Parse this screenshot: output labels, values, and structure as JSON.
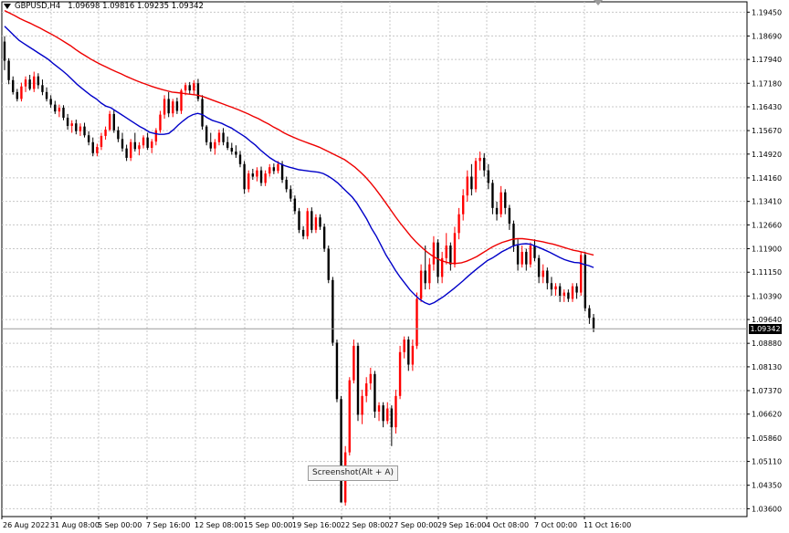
{
  "header": {
    "symbol": "GBPUSD",
    "timeframe": "H4",
    "ohlc": "1.09698 1.09816 1.09235 1.09342"
  },
  "current_price_label": "1.09342",
  "screenshot_hint": "Screenshot(Alt + A)",
  "colors": {
    "background": "#ffffff",
    "grid": "#c8c8c8",
    "bull_candle": "#ff0000",
    "bear_candle": "#000000",
    "ma_fast": "#0000c8",
    "ma_slow": "#ee0000",
    "axis_text": "#000000"
  },
  "chart_data": {
    "type": "candlestick",
    "symbol": "GBPUSD",
    "timeframe": "H4",
    "x_tick_labels": [
      "26 Aug 2022",
      "31 Aug 08:00",
      "5 Sep 00:00",
      "7 Sep 16:00",
      "12 Sep 08:00",
      "15 Sep 00:00",
      "19 Sep 16:00",
      "22 Sep 08:00",
      "27 Sep 00:00",
      "29 Sep 16:00",
      "4 Oct 08:00",
      "7 Oct 00:00",
      "11 Oct 16:00"
    ],
    "y_tick_labels": [
      "1.19450",
      "1.18690",
      "1.17940",
      "1.17180",
      "1.16430",
      "1.15670",
      "1.14920",
      "1.14160",
      "1.13410",
      "1.12660",
      "1.11900",
      "1.11150",
      "1.10390",
      "1.09640",
      "1.08880",
      "1.08130",
      "1.07370",
      "1.06620",
      "1.05860",
      "1.05110",
      "1.04350",
      "1.03600"
    ],
    "ylim": [
      1.0335,
      1.1978
    ],
    "last_price": 1.09342,
    "grid": true,
    "candles": [
      [
        1.1851,
        1.1868,
        1.176,
        1.179
      ],
      [
        1.179,
        1.1798,
        1.1715,
        1.1728
      ],
      [
        1.1728,
        1.174,
        1.1682,
        1.169
      ],
      [
        1.169,
        1.17,
        1.166,
        1.1668
      ],
      [
        1.1668,
        1.172,
        1.166,
        1.1708
      ],
      [
        1.1708,
        1.174,
        1.169,
        1.173
      ],
      [
        1.173,
        1.1745,
        1.1695,
        1.17
      ],
      [
        1.17,
        1.1755,
        1.169,
        1.174
      ],
      [
        1.174,
        1.175,
        1.17,
        1.1712
      ],
      [
        1.1712,
        1.173,
        1.168,
        1.169
      ],
      [
        1.169,
        1.1705,
        1.166,
        1.1668
      ],
      [
        1.1668,
        1.168,
        1.164,
        1.165
      ],
      [
        1.165,
        1.1662,
        1.162,
        1.1628
      ],
      [
        1.1628,
        1.165,
        1.161,
        1.164
      ],
      [
        1.164,
        1.1648,
        1.16,
        1.1608
      ],
      [
        1.1608,
        1.162,
        1.157,
        1.1582
      ],
      [
        1.1582,
        1.16,
        1.156,
        1.159
      ],
      [
        1.159,
        1.1602,
        1.1555,
        1.1565
      ],
      [
        1.1565,
        1.159,
        1.155,
        1.158
      ],
      [
        1.158,
        1.1592,
        1.1545,
        1.1552
      ],
      [
        1.1552,
        1.1565,
        1.152,
        1.153
      ],
      [
        1.153,
        1.1545,
        1.1485,
        1.1495
      ],
      [
        1.1495,
        1.1525,
        1.1485,
        1.1515
      ],
      [
        1.1515,
        1.156,
        1.1505,
        1.155
      ],
      [
        1.155,
        1.158,
        1.1538,
        1.157
      ],
      [
        1.157,
        1.163,
        1.1565,
        1.162
      ],
      [
        1.162,
        1.1632,
        1.156,
        1.1568
      ],
      [
        1.1568,
        1.158,
        1.153,
        1.154
      ],
      [
        1.154,
        1.156,
        1.15,
        1.151
      ],
      [
        1.151,
        1.1522,
        1.147,
        1.148
      ],
      [
        1.148,
        1.154,
        1.147,
        1.153
      ],
      [
        1.153,
        1.156,
        1.15,
        1.1508
      ],
      [
        1.1508,
        1.153,
        1.1488,
        1.152
      ],
      [
        1.152,
        1.1552,
        1.151,
        1.1545
      ],
      [
        1.1545,
        1.156,
        1.1505,
        1.1512
      ],
      [
        1.1512,
        1.154,
        1.1495,
        1.1532
      ],
      [
        1.1532,
        1.1575,
        1.152,
        1.1568
      ],
      [
        1.1568,
        1.163,
        1.156,
        1.1618
      ],
      [
        1.1618,
        1.168,
        1.1605,
        1.1668
      ],
      [
        1.1668,
        1.169,
        1.161,
        1.1622
      ],
      [
        1.1622,
        1.1668,
        1.161,
        1.166
      ],
      [
        1.166,
        1.1672,
        1.162,
        1.163
      ],
      [
        1.163,
        1.17,
        1.162,
        1.1695
      ],
      [
        1.1695,
        1.172,
        1.168,
        1.1712
      ],
      [
        1.1712,
        1.1722,
        1.1685,
        1.1695
      ],
      [
        1.1695,
        1.1728,
        1.168,
        1.1718
      ],
      [
        1.1718,
        1.1732,
        1.166,
        1.1668
      ],
      [
        1.1668,
        1.168,
        1.157,
        1.158
      ],
      [
        1.158,
        1.1585,
        1.152,
        1.153
      ],
      [
        1.153,
        1.156,
        1.15,
        1.151
      ],
      [
        1.151,
        1.154,
        1.149,
        1.153
      ],
      [
        1.153,
        1.157,
        1.152,
        1.156
      ],
      [
        1.156,
        1.1575,
        1.152,
        1.153
      ],
      [
        1.153,
        1.1548,
        1.1505,
        1.1512
      ],
      [
        1.1512,
        1.1528,
        1.149,
        1.15
      ],
      [
        1.15,
        1.152,
        1.148,
        1.149
      ],
      [
        1.149,
        1.1502,
        1.145,
        1.146
      ],
      [
        1.146,
        1.147,
        1.1365,
        1.138
      ],
      [
        1.138,
        1.144,
        1.137,
        1.143
      ],
      [
        1.143,
        1.1445,
        1.141,
        1.142
      ],
      [
        1.142,
        1.145,
        1.1405,
        1.144
      ],
      [
        1.144,
        1.1452,
        1.139,
        1.14
      ],
      [
        1.14,
        1.144,
        1.139,
        1.143
      ],
      [
        1.143,
        1.146,
        1.142,
        1.145
      ],
      [
        1.145,
        1.1462,
        1.1428,
        1.1438
      ],
      [
        1.1438,
        1.147,
        1.143,
        1.146
      ],
      [
        1.146,
        1.147,
        1.14,
        1.141
      ],
      [
        1.141,
        1.142,
        1.137,
        1.138
      ],
      [
        1.138,
        1.1392,
        1.134,
        1.135
      ],
      [
        1.135,
        1.136,
        1.13,
        1.131
      ],
      [
        1.131,
        1.132,
        1.124,
        1.125
      ],
      [
        1.125,
        1.1262,
        1.122,
        1.123
      ],
      [
        1.123,
        1.132,
        1.122,
        1.131
      ],
      [
        1.131,
        1.1322,
        1.124,
        1.125
      ],
      [
        1.125,
        1.13,
        1.124,
        1.129
      ],
      [
        1.129,
        1.13,
        1.125,
        1.126
      ],
      [
        1.126,
        1.127,
        1.118,
        1.119
      ],
      [
        1.119,
        1.12,
        1.108,
        1.109
      ],
      [
        1.109,
        1.11,
        1.088,
        1.089
      ],
      [
        1.089,
        1.09,
        1.07,
        1.071
      ],
      [
        1.071,
        1.072,
        1.04,
        1.038
      ],
      [
        1.038,
        1.056,
        1.037,
        1.054
      ],
      [
        1.054,
        1.078,
        1.053,
        1.077
      ],
      [
        1.077,
        1.09,
        1.076,
        1.088
      ],
      [
        1.088,
        1.089,
        1.064,
        1.066
      ],
      [
        1.066,
        1.074,
        1.063,
        1.072
      ],
      [
        1.072,
        1.078,
        1.07,
        1.076
      ],
      [
        1.076,
        1.081,
        1.074,
        1.079
      ],
      [
        1.079,
        1.08,
        1.065,
        1.067
      ],
      [
        1.067,
        1.07,
        1.064,
        1.069
      ],
      [
        1.069,
        1.07,
        1.062,
        1.064
      ],
      [
        1.064,
        1.07,
        1.063,
        1.068
      ],
      [
        1.068,
        1.069,
        1.056,
        1.062
      ],
      [
        1.062,
        1.074,
        1.06,
        1.072
      ],
      [
        1.072,
        1.088,
        1.071,
        1.086
      ],
      [
        1.086,
        1.091,
        1.084,
        1.09
      ],
      [
        1.09,
        1.091,
        1.08,
        1.082
      ],
      [
        1.082,
        1.09,
        1.08,
        1.088
      ],
      [
        1.088,
        1.105,
        1.087,
        1.103
      ],
      [
        1.103,
        1.114,
        1.102,
        1.112
      ],
      [
        1.112,
        1.12,
        1.106,
        1.108
      ],
      [
        1.108,
        1.116,
        1.106,
        1.114
      ],
      [
        1.114,
        1.123,
        1.112,
        1.121
      ],
      [
        1.121,
        1.122,
        1.108,
        1.11
      ],
      [
        1.11,
        1.118,
        1.108,
        1.116
      ],
      [
        1.116,
        1.124,
        1.114,
        1.12
      ],
      [
        1.12,
        1.121,
        1.112,
        1.114
      ],
      [
        1.114,
        1.126,
        1.113,
        1.124
      ],
      [
        1.124,
        1.132,
        1.122,
        1.13
      ],
      [
        1.13,
        1.138,
        1.128,
        1.136
      ],
      [
        1.136,
        1.144,
        1.134,
        1.142
      ],
      [
        1.142,
        1.146,
        1.136,
        1.138
      ],
      [
        1.138,
        1.148,
        1.137,
        1.147
      ],
      [
        1.147,
        1.15,
        1.144,
        1.148
      ],
      [
        1.148,
        1.1495,
        1.142,
        1.144
      ],
      [
        1.144,
        1.146,
        1.138,
        1.14
      ],
      [
        1.14,
        1.141,
        1.13,
        1.132
      ],
      [
        1.132,
        1.134,
        1.128,
        1.13
      ],
      [
        1.13,
        1.139,
        1.129,
        1.137
      ],
      [
        1.137,
        1.138,
        1.13,
        1.132
      ],
      [
        1.132,
        1.133,
        1.125,
        1.127
      ],
      [
        1.127,
        1.128,
        1.118,
        1.12
      ],
      [
        1.12,
        1.122,
        1.112,
        1.114
      ],
      [
        1.114,
        1.12,
        1.113,
        1.118
      ],
      [
        1.118,
        1.119,
        1.112,
        1.114
      ],
      [
        1.114,
        1.121,
        1.113,
        1.12
      ],
      [
        1.12,
        1.122,
        1.115,
        1.116
      ],
      [
        1.116,
        1.117,
        1.108,
        1.11
      ],
      [
        1.11,
        1.114,
        1.108,
        1.112
      ],
      [
        1.112,
        1.113,
        1.106,
        1.108
      ],
      [
        1.108,
        1.11,
        1.104,
        1.106
      ],
      [
        1.106,
        1.108,
        1.104,
        1.107
      ],
      [
        1.107,
        1.108,
        1.102,
        1.104
      ],
      [
        1.104,
        1.106,
        1.102,
        1.105
      ],
      [
        1.105,
        1.106,
        1.102,
        1.103
      ],
      [
        1.103,
        1.108,
        1.102,
        1.107
      ],
      [
        1.107,
        1.108,
        1.103,
        1.105
      ],
      [
        1.105,
        1.118,
        1.104,
        1.117
      ],
      [
        1.117,
        1.118,
        1.099,
        1.1
      ],
      [
        1.1,
        1.101,
        1.095,
        1.0969
      ],
      [
        1.09698,
        1.09816,
        1.09235,
        1.09342
      ]
    ],
    "ma_fast": {
      "values": [
        1.19,
        1.1885,
        1.187,
        1.1855,
        1.1845,
        1.1835,
        1.1825,
        1.1815,
        1.1805,
        1.1795,
        1.1782,
        1.177,
        1.1758,
        1.1745,
        1.173,
        1.1715,
        1.1702,
        1.169,
        1.1678,
        1.1668,
        1.1655,
        1.1645,
        1.164,
        1.163,
        1.162,
        1.161,
        1.16,
        1.159,
        1.158,
        1.1572,
        1.1562,
        1.1558,
        1.1555,
        1.1555,
        1.1558,
        1.157,
        1.1585,
        1.1598,
        1.161,
        1.1618,
        1.1622,
        1.1618,
        1.1608,
        1.16,
        1.1595,
        1.159,
        1.1582,
        1.1575,
        1.1565,
        1.1555,
        1.1545,
        1.1532,
        1.152,
        1.1505,
        1.1492,
        1.148,
        1.147,
        1.1462,
        1.1455,
        1.145,
        1.1446,
        1.1442,
        1.144,
        1.1438,
        1.1436,
        1.1434,
        1.143,
        1.1422,
        1.1412,
        1.14,
        1.1385,
        1.137,
        1.1355,
        1.1335,
        1.131,
        1.1285,
        1.1255,
        1.123,
        1.12,
        1.117,
        1.1145,
        1.112,
        1.1098,
        1.1078,
        1.1058,
        1.1042,
        1.1028,
        1.1018,
        1.1012,
        1.1018,
        1.1028,
        1.1038,
        1.105,
        1.1062,
        1.1075,
        1.1088,
        1.1102,
        1.1115,
        1.1128,
        1.114,
        1.1152,
        1.116,
        1.117,
        1.118,
        1.1188,
        1.1196,
        1.1202,
        1.1205,
        1.1206,
        1.1204,
        1.1198,
        1.1192,
        1.1185,
        1.1178,
        1.117,
        1.1162,
        1.1155,
        1.115,
        1.1146,
        1.1145,
        1.114,
        1.1136,
        1.113
      ],
      "x_start": 0
    },
    "ma_slow": {
      "values": [
        1.195,
        1.1942,
        1.1934,
        1.1925,
        1.1917,
        1.191,
        1.1902,
        1.1894,
        1.1885,
        1.1877,
        1.1868,
        1.1858,
        1.1848,
        1.1838,
        1.1826,
        1.1815,
        1.1805,
        1.1795,
        1.1786,
        1.1778,
        1.177,
        1.1762,
        1.1755,
        1.1748,
        1.174,
        1.1733,
        1.1726,
        1.172,
        1.1714,
        1.1708,
        1.1703,
        1.1698,
        1.1694,
        1.169,
        1.1688,
        1.1686,
        1.1684,
        1.1682,
        1.168,
        1.1676,
        1.167,
        1.1664,
        1.1658,
        1.1652,
        1.1646,
        1.164,
        1.1634,
        1.1627,
        1.162,
        1.1612,
        1.1605,
        1.1596,
        1.1588,
        1.1578,
        1.157,
        1.156,
        1.1552,
        1.1545,
        1.1538,
        1.1532,
        1.1526,
        1.152,
        1.1514,
        1.1506,
        1.1498,
        1.149,
        1.1482,
        1.1474,
        1.1462,
        1.145,
        1.1436,
        1.142,
        1.1402,
        1.1382,
        1.136,
        1.1338,
        1.1315,
        1.1292,
        1.127,
        1.125,
        1.123,
        1.1212,
        1.1197,
        1.1182,
        1.117,
        1.116,
        1.1152,
        1.1147,
        1.1143,
        1.1143,
        1.1145,
        1.115,
        1.1157,
        1.1165,
        1.1175,
        1.1185,
        1.1195,
        1.1203,
        1.121,
        1.1215,
        1.122,
        1.1222,
        1.1222,
        1.122,
        1.1218,
        1.1215,
        1.1212,
        1.1208,
        1.1205,
        1.12,
        1.1195,
        1.119,
        1.1185,
        1.1182,
        1.1178,
        1.1174,
        1.117
      ],
      "x_start": 0
    }
  }
}
